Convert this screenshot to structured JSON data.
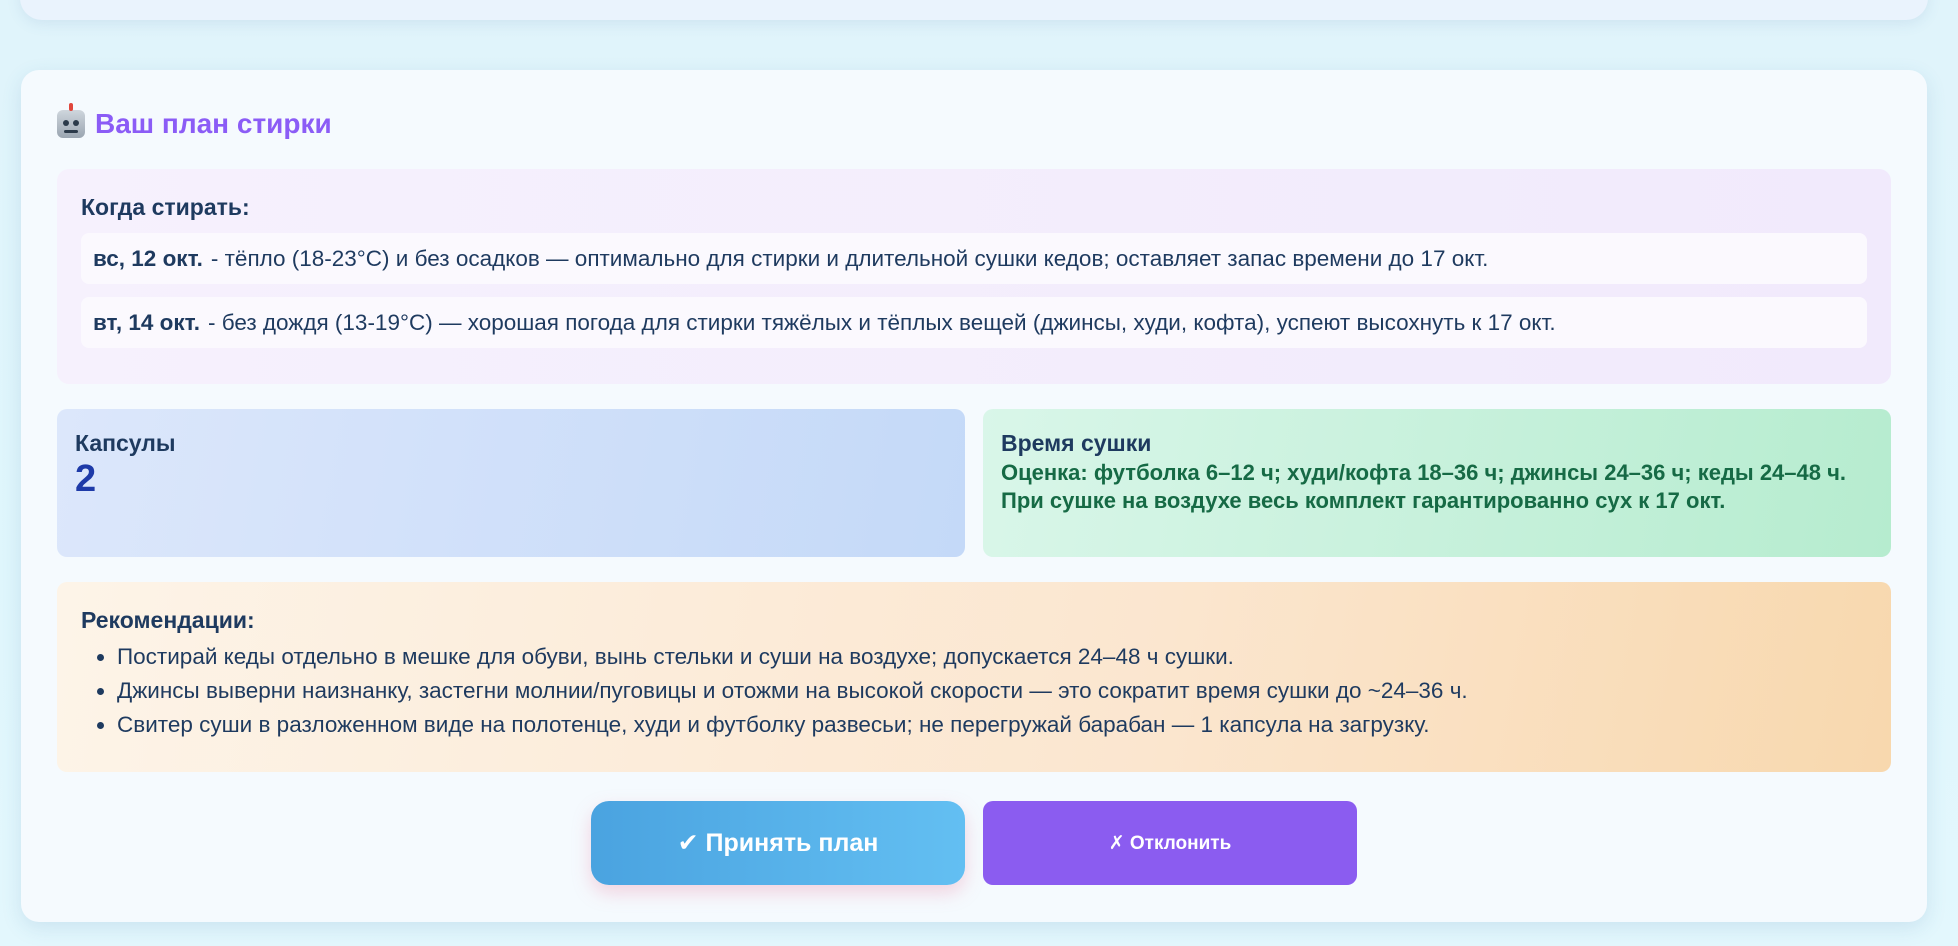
{
  "plan": {
    "title": "Ваш план стирки",
    "when_label": "Когда стирать:",
    "days": [
      {
        "date": "вс, 12 окт.",
        "text": "- тёпло (18-23°C) и без осадков — оптимально для стирки и длительной сушки кедов; оставляет запас времени до 17 окт."
      },
      {
        "date": "вт, 14 окт.",
        "text": "- без дождя (13-19°C) — хорошая погода для стирки тяжёлых и тёплых вещей (джинсы, худи, кофта), успеют высохнуть к 17 окт."
      }
    ],
    "capsules_label": "Капсулы",
    "capsules_value": "2",
    "drying_label": "Время сушки",
    "drying_text": "Оценка: футболка 6–12 ч; худи/кофта 18–36 ч; джинсы 24–36 ч; кеды 24–48 ч. При сушке на воздухе весь комплект гарантированно сух к 17 окт.",
    "recommendations_label": "Рекомендации:",
    "recommendations": [
      "Постирай кеды отдельно в мешке для обуви, вынь стельки и суши на воздухе; допускается 24–48 ч сушки.",
      "Джинсы выверни наизнанку, застегни молнии/пуговицы и отожми на высокой скорости — это сократит время сушки до ~24–36 ч.",
      "Свитер суши в разложенном виде на полотенце, худи и футболку развесьи; не перегружай барабан — 1 капсула на загрузку."
    ]
  },
  "actions": {
    "accept_label": "✔ Принять план",
    "decline_label": "✗ Отклонить"
  },
  "colors": {
    "title": "#8b5cf6",
    "accept_bg": "#4aa3e0",
    "decline_bg": "#8b5cf0",
    "capsules_value": "#1e3aa8",
    "drying_text": "#166a45"
  },
  "icons": {
    "title_icon": "robot-icon"
  }
}
